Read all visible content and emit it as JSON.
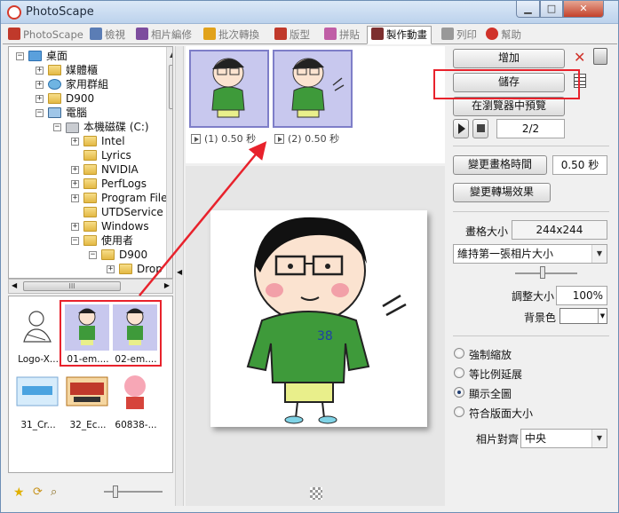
{
  "window": {
    "title": "PhotoScape"
  },
  "tabs": [
    {
      "label": "PhotoScape",
      "color": "#c0392b"
    },
    {
      "label": "檢視",
      "color": "#5b7db5"
    },
    {
      "label": "相片編修",
      "color": "#7d4d9e"
    },
    {
      "label": "批次轉換",
      "color": "#e1a21b"
    },
    {
      "label": "版型",
      "color": "#c0392b"
    },
    {
      "label": "拼貼",
      "color": "#c05ea6"
    },
    {
      "label": "製作動畫",
      "color": "#7d2f2f",
      "active": true
    },
    {
      "label": "列印",
      "color": "#777777"
    },
    {
      "label": "幫助",
      "color": "#d0322a"
    }
  ],
  "tree": {
    "desktop": "桌面",
    "library": "媒體櫃",
    "homegroup": "家用群組",
    "user": "D900",
    "computer": "電腦",
    "drive": "本機磁碟 (C:)",
    "folders": [
      "Intel",
      "Lyrics",
      "NVIDIA",
      "PerfLogs",
      "Program File",
      "UTDService",
      "Windows",
      "使用者"
    ],
    "subuser": "D900",
    "subfolder": "Drop"
  },
  "scrollbar": {
    "thumb_grip": "III"
  },
  "thumbnails": [
    {
      "label": "Logo-X...",
      "selected": false
    },
    {
      "label": "01-em....",
      "selected": true
    },
    {
      "label": "02-em....",
      "selected": true
    },
    {
      "label": "31_Cr...",
      "selected": false
    },
    {
      "label": "32_Ec...",
      "selected": false
    },
    {
      "label": "60838-...",
      "selected": false
    }
  ],
  "frames": [
    {
      "label": "(1) 0.50 秒"
    },
    {
      "label": "(2) 0.50 秒"
    }
  ],
  "controls": {
    "add": "增加",
    "save": "儲存",
    "preview_browser": "在瀏覽器中預覽",
    "frame_counter": "2/2",
    "change_frame_time": "變更畫格時間",
    "frame_time_value": "0.50 秒",
    "change_transition": "變更轉場效果",
    "frame_size_label": "畫格大小",
    "frame_size_value": "244x244",
    "size_mode": "維持第一張相片大小",
    "resize_label": "調整大小",
    "resize_value": "100%",
    "bg_color_label": "背景色",
    "bg_color": "#ffffff",
    "radio_options": [
      "強制縮放",
      "等比例延展",
      "顯示全圖",
      "符合版面大小"
    ],
    "radio_selected": "顯示全圖",
    "align_label": "相片對齊",
    "align_value": "中央"
  },
  "colors": {
    "highlight_box": "#e8222c",
    "frame_bg": "#c8c8ee",
    "shirt": "#3e9a3a",
    "shorts": "#e9ef8b"
  }
}
